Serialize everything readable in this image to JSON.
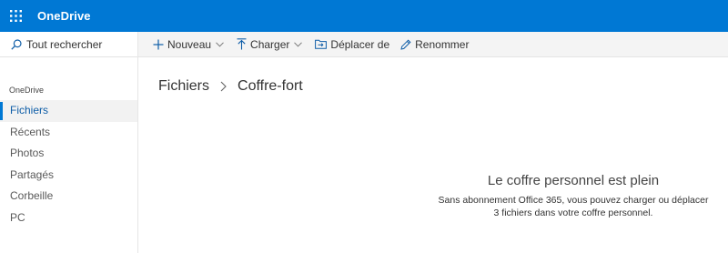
{
  "topbar": {
    "brand": "OneDrive",
    "accent_color": "#0078d4",
    "launcher_icon": "app-launcher-waffle-icon"
  },
  "sidebar": {
    "search_label": "Tout rechercher",
    "section_heading": "OneDrive",
    "items": [
      {
        "label": "Fichiers",
        "active": true
      },
      {
        "label": "Récents",
        "active": false
      },
      {
        "label": "Photos",
        "active": false
      },
      {
        "label": "Partagés",
        "active": false
      },
      {
        "label": "Corbeille",
        "active": false
      },
      {
        "label": "PC",
        "active": false
      }
    ]
  },
  "commandbar": {
    "new_label": "Nouveau",
    "upload_label": "Charger",
    "move_label": "Déplacer de",
    "rename_label": "Renommer"
  },
  "breadcrumb": {
    "root": "Fichiers",
    "current": "Coffre-fort"
  },
  "empty_state": {
    "title": "Le coffre personnel est plein",
    "line1": "Sans abonnement Office 365, vous pouvez charger ou déplacer",
    "line2": "3 fichiers dans votre coffre personnel."
  }
}
